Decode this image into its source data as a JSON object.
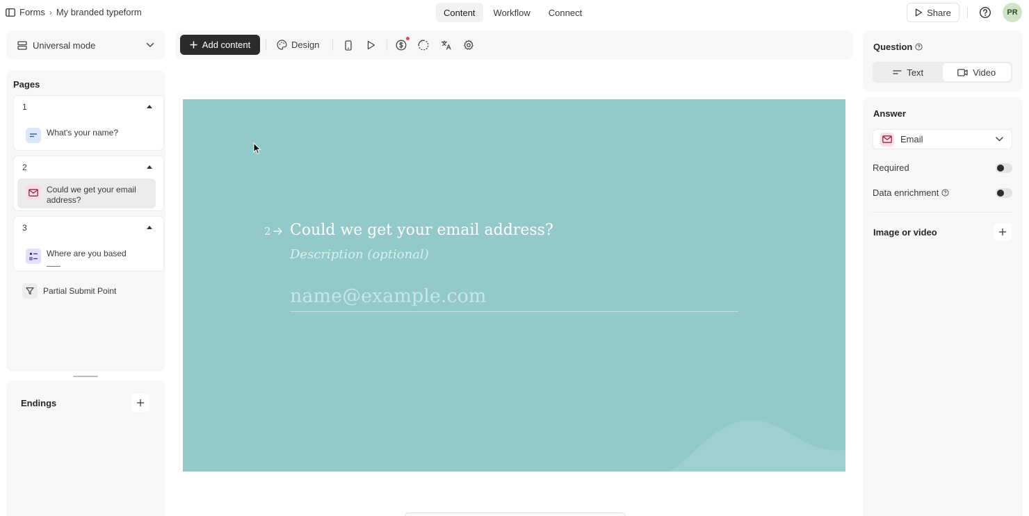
{
  "breadcrumb": {
    "root": "Forms",
    "current": "My branded typeform"
  },
  "nav_tabs": [
    {
      "label": "Content",
      "active": true
    },
    {
      "label": "Workflow",
      "active": false
    },
    {
      "label": "Connect",
      "active": false
    }
  ],
  "header": {
    "share_label": "Share",
    "avatar_initials": "PR"
  },
  "mode_select": {
    "label": "Universal mode"
  },
  "pages": {
    "title": "Pages",
    "groups": [
      {
        "number": "1",
        "question": "What's your name?",
        "icon": "short-text-icon"
      },
      {
        "number": "2",
        "question_line1": "Could we get your email",
        "question_line2": "address?",
        "icon": "mail-icon",
        "selected": true
      },
      {
        "number": "3",
        "question": "Where are you based",
        "icon": "multiple-choice-icon"
      }
    ],
    "partial_submit": "Partial Submit Point"
  },
  "endings": {
    "title": "Endings"
  },
  "toolbar": {
    "add_content_label": "Add content",
    "design_label": "Design",
    "icons": [
      "mobile-preview-icon",
      "play-icon",
      "dollar-icon",
      "loading-icon",
      "translate-icon",
      "gear-icon"
    ]
  },
  "canvas": {
    "background": "#93c9c9",
    "question_number": "2",
    "question_title": "Could we get your email address?",
    "description_placeholder": "Description (optional)",
    "input_placeholder": "name@example.com"
  },
  "right_panel": {
    "question_label": "Question",
    "question_types": [
      {
        "label": "Text",
        "active": true
      },
      {
        "label": "Video",
        "active": false
      }
    ],
    "answer_label": "Answer",
    "answer_type": "Email",
    "required_label": "Required",
    "data_enrichment_label": "Data enrichment",
    "image_video_label": "Image or video"
  }
}
